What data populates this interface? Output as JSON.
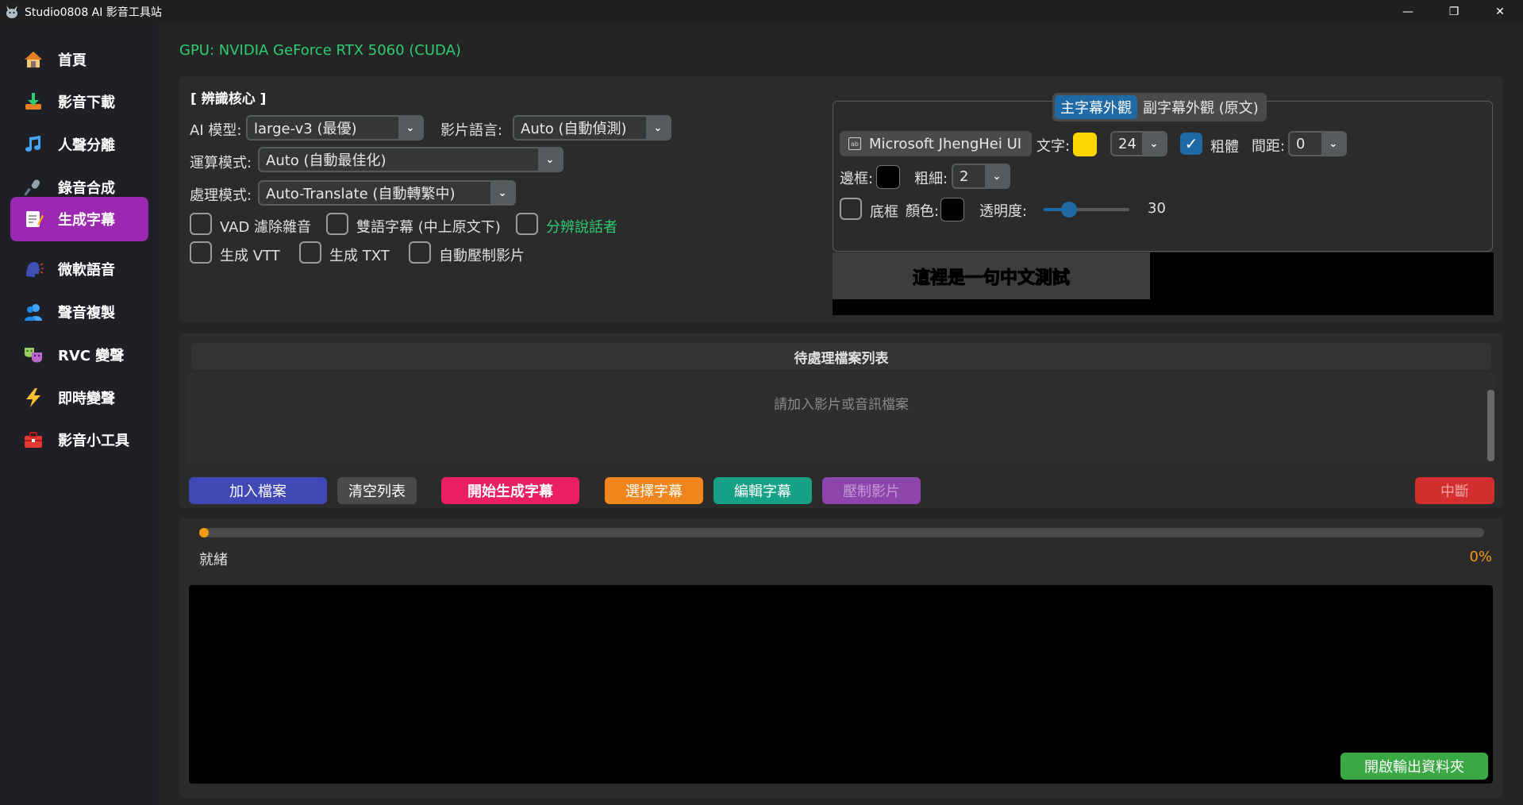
{
  "window": {
    "title": "Studio0808 AI 影音工具站",
    "controls": [
      "—",
      "❐",
      "✕"
    ]
  },
  "sidebar": {
    "items": [
      {
        "label": "首頁",
        "icon": "house-icon"
      },
      {
        "label": "影音下載",
        "icon": "download-icon"
      },
      {
        "label": "人聲分離",
        "icon": "music-note-icon"
      },
      {
        "label": "錄音合成",
        "icon": "microphone-icon"
      },
      {
        "label": "生成字幕",
        "icon": "memo-icon"
      },
      {
        "label": "微軟語音",
        "icon": "speaking-head-icon"
      },
      {
        "label": "聲音複製",
        "icon": "people-icon"
      },
      {
        "label": "RVC 變聲",
        "icon": "masks-icon"
      },
      {
        "label": "即時變聲",
        "icon": "lightning-icon"
      },
      {
        "label": "影音小工具",
        "icon": "toolbox-icon"
      }
    ],
    "active_index": 4
  },
  "gpu_status": "GPU: NVIDIA GeForce RTX 5060 (CUDA)",
  "core": {
    "title": "[ 辨識核心 ]",
    "model_label": "AI 模型:",
    "model_value": "large-v3 (最優)",
    "lang_label": "影片語言:",
    "lang_value": "Auto (自動偵測)",
    "compute_label": "運算模式:",
    "compute_value": "Auto (自動最佳化)",
    "process_label": "處理模式:",
    "process_value": "Auto-Translate (自動轉繁中)",
    "checkboxes": {
      "vad": "VAD 濾除雜音",
      "bilingual": "雙語字幕 (中上原文下)",
      "diarize": "分辨說話者",
      "vtt": "生成 VTT",
      "txt": "生成 TXT",
      "burn": "自動壓制影片"
    }
  },
  "style": {
    "tabs": [
      "主字幕外觀",
      "副字幕外觀 (原文)"
    ],
    "font_name": "Microsoft JhengHei UI",
    "text_label": "文字:",
    "text_color": "#ffd700",
    "size_value": "24",
    "bold_label": "粗體",
    "spacing_label": "間距:",
    "spacing_value": "0",
    "border_label": "邊框:",
    "border_color": "#000000",
    "thickness_label": "粗細:",
    "thickness_value": "2",
    "bg_label": "底框",
    "bg_color_label": "顏色:",
    "bg_color": "#000000",
    "opacity_label": "透明度:",
    "opacity_value": "30",
    "opacity_fraction": 0.3,
    "preview_text": "這裡是一句中文測試"
  },
  "queue": {
    "title": "待處理檔案列表",
    "placeholder": "請加入影片或音訊檔案"
  },
  "buttons": {
    "add": "加入檔案",
    "clear": "清空列表",
    "start": "開始生成字幕",
    "select": "選擇字幕",
    "edit": "編輯字幕",
    "burn": "壓制影片",
    "stop": "中斷",
    "open_output": "開啟輸出資料夾"
  },
  "progress": {
    "status": "就緒",
    "percent_text": "0%",
    "value": 0
  },
  "colors": {
    "accent": "#1f6aa5",
    "active_nav": "#9c27b0",
    "gpu_green": "#2ecc71",
    "add_btn": "#3f48b5",
    "clear_btn": "#4a4a4a",
    "start_btn": "#e91e63",
    "select_btn": "#f0861d",
    "edit_btn": "#16a085",
    "burn_btn": "#8e44ad",
    "stop_btn": "#d32f2f",
    "open_btn": "#3aa843",
    "progress": "#f39c12"
  }
}
